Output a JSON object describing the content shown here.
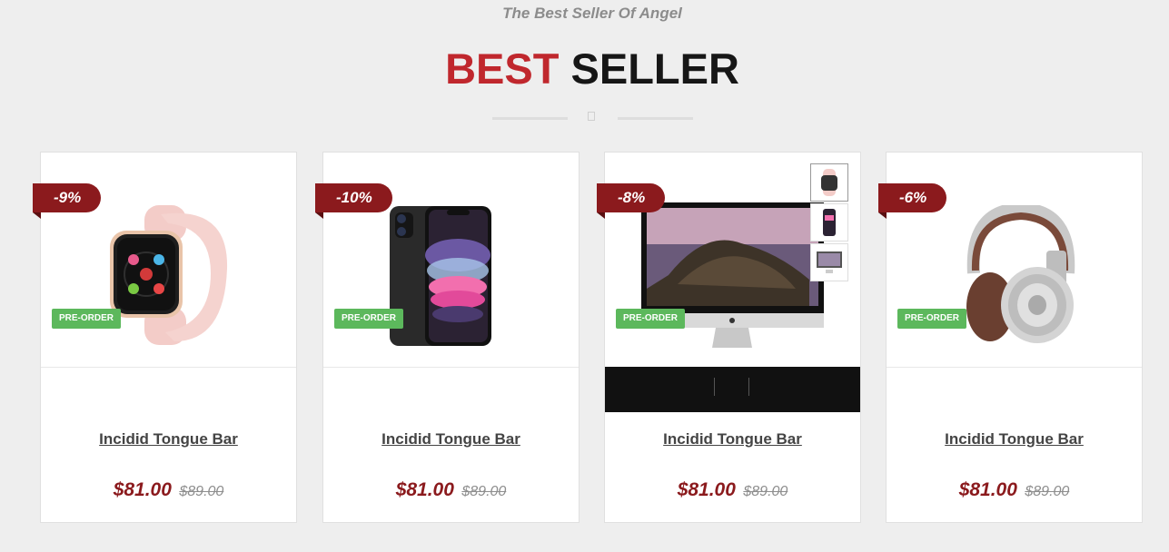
{
  "section": {
    "subtitle": "The Best Seller Of Angel",
    "title_accent": "BEST",
    "title_rest": "SELLER"
  },
  "products": [
    {
      "discount": "-9%",
      "badge": "PRE-ORDER",
      "name": "Incidid Tongue Bar",
      "price": "$81.00",
      "old_price": "$89.00",
      "image": "apple-watch-image"
    },
    {
      "discount": "-10%",
      "badge": "PRE-ORDER",
      "name": "Incidid Tongue Bar",
      "price": "$81.00",
      "old_price": "$89.00",
      "image": "iphone-image"
    },
    {
      "discount": "-8%",
      "badge": "PRE-ORDER",
      "name": "Incidid Tongue Bar",
      "price": "$81.00",
      "old_price": "$89.00",
      "image": "imac-image"
    },
    {
      "discount": "-6%",
      "badge": "PRE-ORDER",
      "name": "Incidid Tongue Bar",
      "price": "$81.00",
      "old_price": "$89.00",
      "image": "headphones-image"
    }
  ],
  "colors": {
    "accent": "#c0272d",
    "discount_bg": "#8b1a1d",
    "preorder_bg": "#5cb85c"
  }
}
